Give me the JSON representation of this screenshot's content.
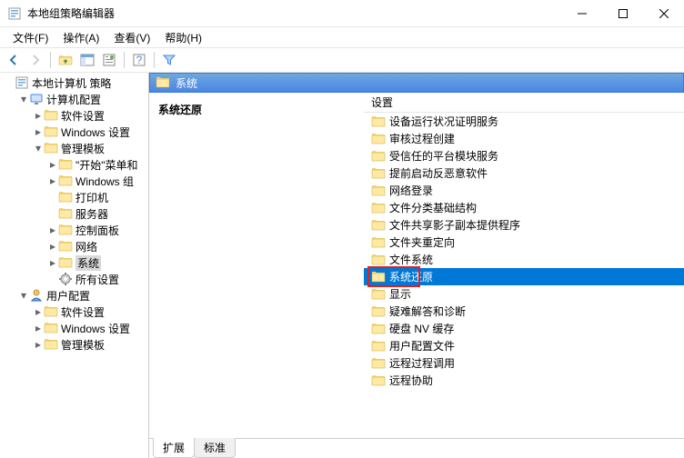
{
  "window": {
    "title": "本地组策略编辑器"
  },
  "menus": {
    "file": "文件(F)",
    "action": "操作(A)",
    "view": "查看(V)",
    "help": "帮助(H)"
  },
  "tree": {
    "root": "本地计算机 策略",
    "computer": "计算机配置",
    "comp_sw": "软件设置",
    "comp_win": "Windows 设置",
    "comp_tmpl": "管理模板",
    "tmpl_start": "\"开始\"菜单和",
    "tmpl_wincomp": "Windows 组",
    "tmpl_printer": "打印机",
    "tmpl_server": "服务器",
    "tmpl_cpanel": "控制面板",
    "tmpl_network": "网络",
    "tmpl_system": "系统",
    "tmpl_allset": "所有设置",
    "user": "用户配置",
    "user_sw": "软件设置",
    "user_win": "Windows 设置",
    "user_tmpl": "管理模板"
  },
  "detail": {
    "header": "系统",
    "category": "系统还原",
    "column": "设置",
    "items": [
      "设备运行状况证明服务",
      "审核过程创建",
      "受信任的平台模块服务",
      "提前启动反恶意软件",
      "网络登录",
      "文件分类基础结构",
      "文件共享影子副本提供程序",
      "文件夹重定向",
      "文件系统",
      "系统还原",
      "显示",
      "疑难解答和诊断",
      "硬盘 NV 缓存",
      "用户配置文件",
      "远程过程调用",
      "远程协助"
    ],
    "selected_index": 9
  },
  "tabs": {
    "ext": "扩展",
    "std": "标准"
  }
}
